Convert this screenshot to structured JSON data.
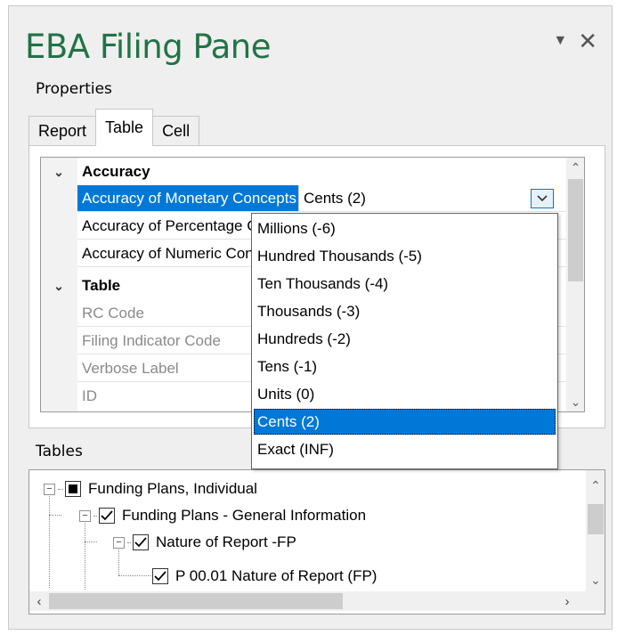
{
  "pane": {
    "title": "EBA Filing Pane",
    "pin_icon": "dropdown-arrow-icon",
    "close_icon": "close-icon"
  },
  "properties": {
    "label": "Properties",
    "tabs": [
      {
        "label": "Report"
      },
      {
        "label": "Table",
        "active": true
      },
      {
        "label": "Cell"
      }
    ],
    "grid": {
      "categories": [
        {
          "label": "Accuracy"
        },
        {
          "label": "Table"
        }
      ],
      "rows": [
        {
          "name": "Accuracy of Monetary Concepts",
          "value": "Cents (2)"
        },
        {
          "name": "Accuracy of Percentage Concepts",
          "value": ""
        },
        {
          "name": "Accuracy of Numeric Concepts",
          "value": ""
        },
        {
          "name": "RC Code",
          "value": ""
        },
        {
          "name": "Filing Indicator Code",
          "value": ""
        },
        {
          "name": "Verbose Label",
          "value": ""
        },
        {
          "name": "ID",
          "value": ""
        }
      ]
    },
    "dropdown_options": [
      "Millions (-6)",
      "Hundred Thousands (-5)",
      "Ten Thousands (-4)",
      "Thousands (-3)",
      "Hundreds (-2)",
      "Tens (-1)",
      "Units (0)",
      "Cents (2)",
      "Exact (INF)"
    ],
    "selected_option": "Cents (2)"
  },
  "tables": {
    "label": "Tables",
    "tree": [
      {
        "label": "Funding Plans, Individual",
        "state": "partial",
        "expanded": true
      },
      {
        "label": "Funding Plans - General Information",
        "state": "checked",
        "expanded": true
      },
      {
        "label": "Nature of Report -FP",
        "state": "checked",
        "expanded": true
      },
      {
        "label": "P 00.01 Nature of Report (FP)",
        "state": "checked"
      }
    ]
  },
  "colors": {
    "title": "#217346",
    "selection": "#0078d7"
  }
}
